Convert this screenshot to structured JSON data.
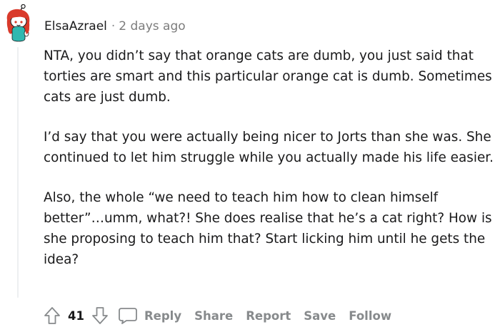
{
  "comment": {
    "author": "ElsaAzrael",
    "separator": "·",
    "timestamp": "2 days ago",
    "paragraphs": [
      "NTA, you didn’t say that orange cats are dumb, you just said that torties are smart and this particular orange cat is dumb. Sometimes cats are just dumb.",
      "I’d say that you were actually being nicer to Jorts than she was. She continued to let him struggle while you actually made his life easier.",
      "Also, the whole “we need to teach him how to clean himself better”…umm, what?! She does realise that he’s a cat right? How is she proposing to teach him that? Start licking him until he gets the idea?"
    ]
  },
  "actions": {
    "upvote_icon": "arrow-up-icon",
    "score": "41",
    "downvote_icon": "arrow-down-icon",
    "reply_icon": "speech-bubble-icon",
    "reply_label": "Reply",
    "share_label": "Share",
    "report_label": "Report",
    "save_label": "Save",
    "follow_label": "Follow"
  },
  "colors": {
    "text": "#1a1a1b",
    "muted": "#878a8c",
    "avatar_hair": "#d93a2b",
    "avatar_outfit": "#2fb8b0"
  }
}
